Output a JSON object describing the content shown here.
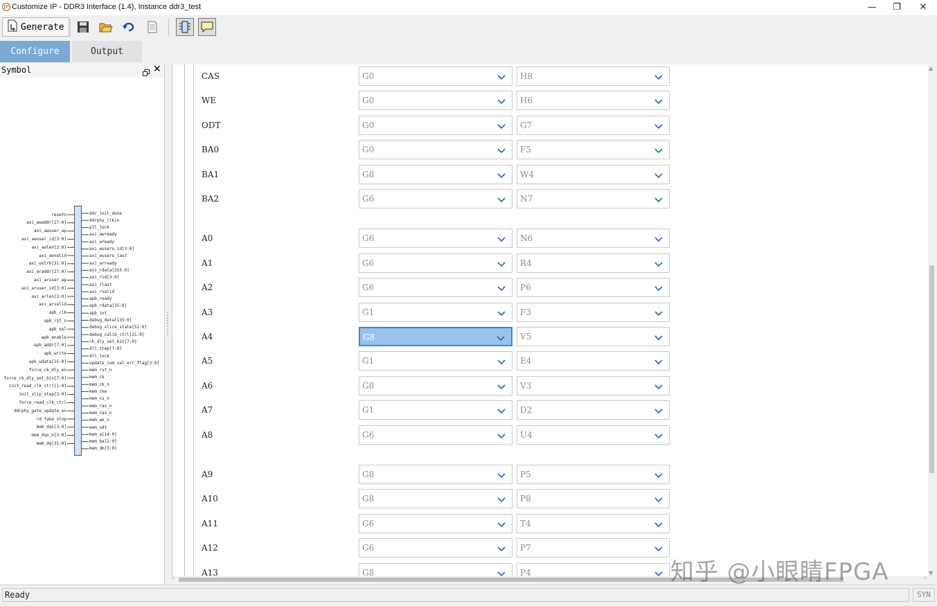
{
  "window": {
    "title": "Customize IP - DDR3 Interface (1.4), Instance ddr3_test",
    "app_icon": "IP",
    "minimize": "—",
    "restore": "❐",
    "close": "✕"
  },
  "toolbar": {
    "generate_label": "Generate",
    "icons": [
      "save-icon",
      "open-folder-icon",
      "refresh-icon",
      "document-icon",
      "chip-view-icon",
      "comment-icon"
    ]
  },
  "tabs": [
    {
      "label": "Configure",
      "active": true
    },
    {
      "label": "Output",
      "active": false
    }
  ],
  "symbol_panel": {
    "title": "Symbol",
    "left_ports": [
      "resetn",
      "axi_awaddr[27:0]",
      "axi_awuser_ap",
      "axi_awuser_id[3:0]",
      "axi_awlen[3:0]",
      "axi_awvalid",
      "axi_wstrb[31:0]",
      "axi_araddr[27:0]",
      "axi_aruser_ap",
      "axi_aruser_id[3:0]",
      "axi_arlen[3:0]",
      "axi_arvalid",
      "apb_clk",
      "apb_rst_n",
      "apb_sel",
      "apb_enable",
      "apb_addr[7:0]",
      "apb_write",
      "apb_wdata[15:0]",
      "force_ck_dly_en",
      "force_ck_dly_set_bin[7:0]",
      "init_read_clk_ctrl[1:0]",
      "init_slip_step[3:0]",
      "force_read_clk_ctrl",
      "ddrphy_gate_update_en",
      "rd_fake_stop",
      "mem_dqs[3:0]",
      "mem_dqs_n[3:0]",
      "mem_dq[31:0]"
    ],
    "right_ports": [
      "ddr_init_done",
      "ddrphy_clkin",
      "pll_lock",
      "axi_awready",
      "axi_wready",
      "axi_wusero_id[3:0]",
      "axi_wusero_last",
      "axi_arready",
      "axi_rdata[255:0]",
      "axi_rid[3:0]",
      "axi_rlast",
      "axi_rvalid",
      "apb_ready",
      "apb_rdata[15:0]",
      "apb_int",
      "debug_data[135:0]",
      "debug_slice_state[51:0]",
      "debug_calib_ctrl[21:0]",
      "ck_dly_set_bin[7:0]",
      "dll_step[7:0]",
      "dll_lock",
      "update_com_val_err_flag[3:0]",
      "mem_rst_n",
      "mem_ck",
      "mem_ck_n",
      "mem_cke",
      "mem_cs_n",
      "mem_ras_n",
      "mem_cas_n",
      "mem_we_n",
      "mem_odt",
      "mem_a[14:0]",
      "mem_ba[2:0]",
      "mem_dm[3:0]"
    ]
  },
  "pin_rows": [
    {
      "name": "CAS",
      "bank": "G0",
      "pin": "H8"
    },
    {
      "name": "WE",
      "bank": "G0",
      "pin": "H6"
    },
    {
      "name": "ODT",
      "bank": "G0",
      "pin": "G7"
    },
    {
      "name": "BA0",
      "bank": "G0",
      "pin": "F5"
    },
    {
      "name": "BA1",
      "bank": "G8",
      "pin": "W4"
    },
    {
      "name": "BA2",
      "bank": "G6",
      "pin": "N7"
    },
    {
      "name": "A0",
      "bank": "G6",
      "pin": "N6"
    },
    {
      "name": "A1",
      "bank": "G6",
      "pin": "R4"
    },
    {
      "name": "A2",
      "bank": "G6",
      "pin": "P6"
    },
    {
      "name": "A3",
      "bank": "G1",
      "pin": "F3"
    },
    {
      "name": "A4",
      "bank": "G8",
      "pin": "V5",
      "selected": true
    },
    {
      "name": "A5",
      "bank": "G1",
      "pin": "E4"
    },
    {
      "name": "A6",
      "bank": "G8",
      "pin": "V3"
    },
    {
      "name": "A7",
      "bank": "G1",
      "pin": "D2"
    },
    {
      "name": "A8",
      "bank": "G6",
      "pin": "U4"
    },
    {
      "name": "A9",
      "bank": "G8",
      "pin": "P5"
    },
    {
      "name": "A10",
      "bank": "G8",
      "pin": "P8"
    },
    {
      "name": "A11",
      "bank": "G6",
      "pin": "T4"
    },
    {
      "name": "A12",
      "bank": "G6",
      "pin": "P7"
    },
    {
      "name": "A13",
      "bank": "G8",
      "pin": "P4"
    }
  ],
  "status": {
    "text": "Ready",
    "indicator": "SYN"
  },
  "watermark": "知乎 @小眼睛FPGA",
  "colors": {
    "accent": "#7aa9d6",
    "selection": "#99c2ec",
    "selection_border": "#3f84d0"
  }
}
